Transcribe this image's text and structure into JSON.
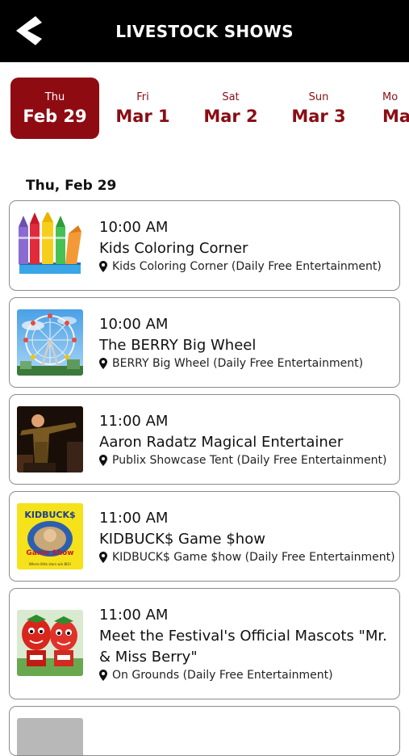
{
  "header": {
    "title": "LIVESTOCK SHOWS",
    "back_icon": "chevron-left-icon"
  },
  "dates": [
    {
      "dow": "Thu",
      "dm": "Feb 29",
      "selected": true
    },
    {
      "dow": "Fri",
      "dm": "Mar 1"
    },
    {
      "dow": "Sat",
      "dm": "Mar 2"
    },
    {
      "dow": "Sun",
      "dm": "Mar 3"
    },
    {
      "dow": "Mo",
      "dm": "Ma"
    }
  ],
  "section": {
    "heading": "Thu, Feb 29"
  },
  "events": [
    {
      "time": "10:00 AM",
      "name": "Kids Coloring Corner",
      "location": "Kids Coloring Corner (Daily Free Entertainment)",
      "icon": "map-pin-icon"
    },
    {
      "time": "10:00 AM",
      "name": "The BERRY Big Wheel",
      "location": "BERRY Big Wheel (Daily Free Entertainment)",
      "icon": "map-pin-icon"
    },
    {
      "time": "11:00 AM",
      "name": "Aaron Radatz Magical Entertainer",
      "location": "Publix Showcase Tent (Daily Free Entertainment)",
      "icon": "map-pin-icon"
    },
    {
      "time": "11:00 AM",
      "name": "KIDBUCK$ Game $how",
      "location": "KIDBUCK$ Game $how (Daily Free Entertainment)",
      "icon": "map-pin-icon",
      "thumb_text": [
        "KIDBUCK$",
        "Game $how",
        "Where little stars win BIG!"
      ]
    },
    {
      "time": "11:00 AM",
      "name": "Meet the Festival's Official Mascots \"Mr. & Miss Berry\"",
      "location": "On Grounds (Daily Free Entertainment)",
      "icon": "map-pin-icon"
    }
  ],
  "colors": {
    "accent": "#8f0b12",
    "header_bg": "#000000"
  }
}
